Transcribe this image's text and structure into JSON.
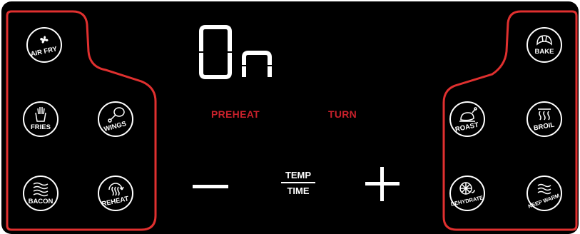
{
  "display": {
    "text": "On"
  },
  "indicators": {
    "preheat": "PREHEAT",
    "turn": "TURN"
  },
  "controls": {
    "minus": "—",
    "plus": "+",
    "temp": "TEMP",
    "time": "TIME"
  },
  "left_buttons": {
    "air_fry": "AIR FRY",
    "fries": "FRIES",
    "wings": "WINGS",
    "bacon": "BACON",
    "reheat": "REHEAT"
  },
  "right_buttons": {
    "bake": "BAKE",
    "roast": "ROAST",
    "broil": "BROIL",
    "dehydrate": "DEHYDRATE",
    "keep_warm": "KEEP WARM"
  },
  "colors": {
    "panel": "#000000",
    "accent_red": "#c8212b",
    "outline_red": "#e0302f",
    "foreground": "#ffffff"
  }
}
